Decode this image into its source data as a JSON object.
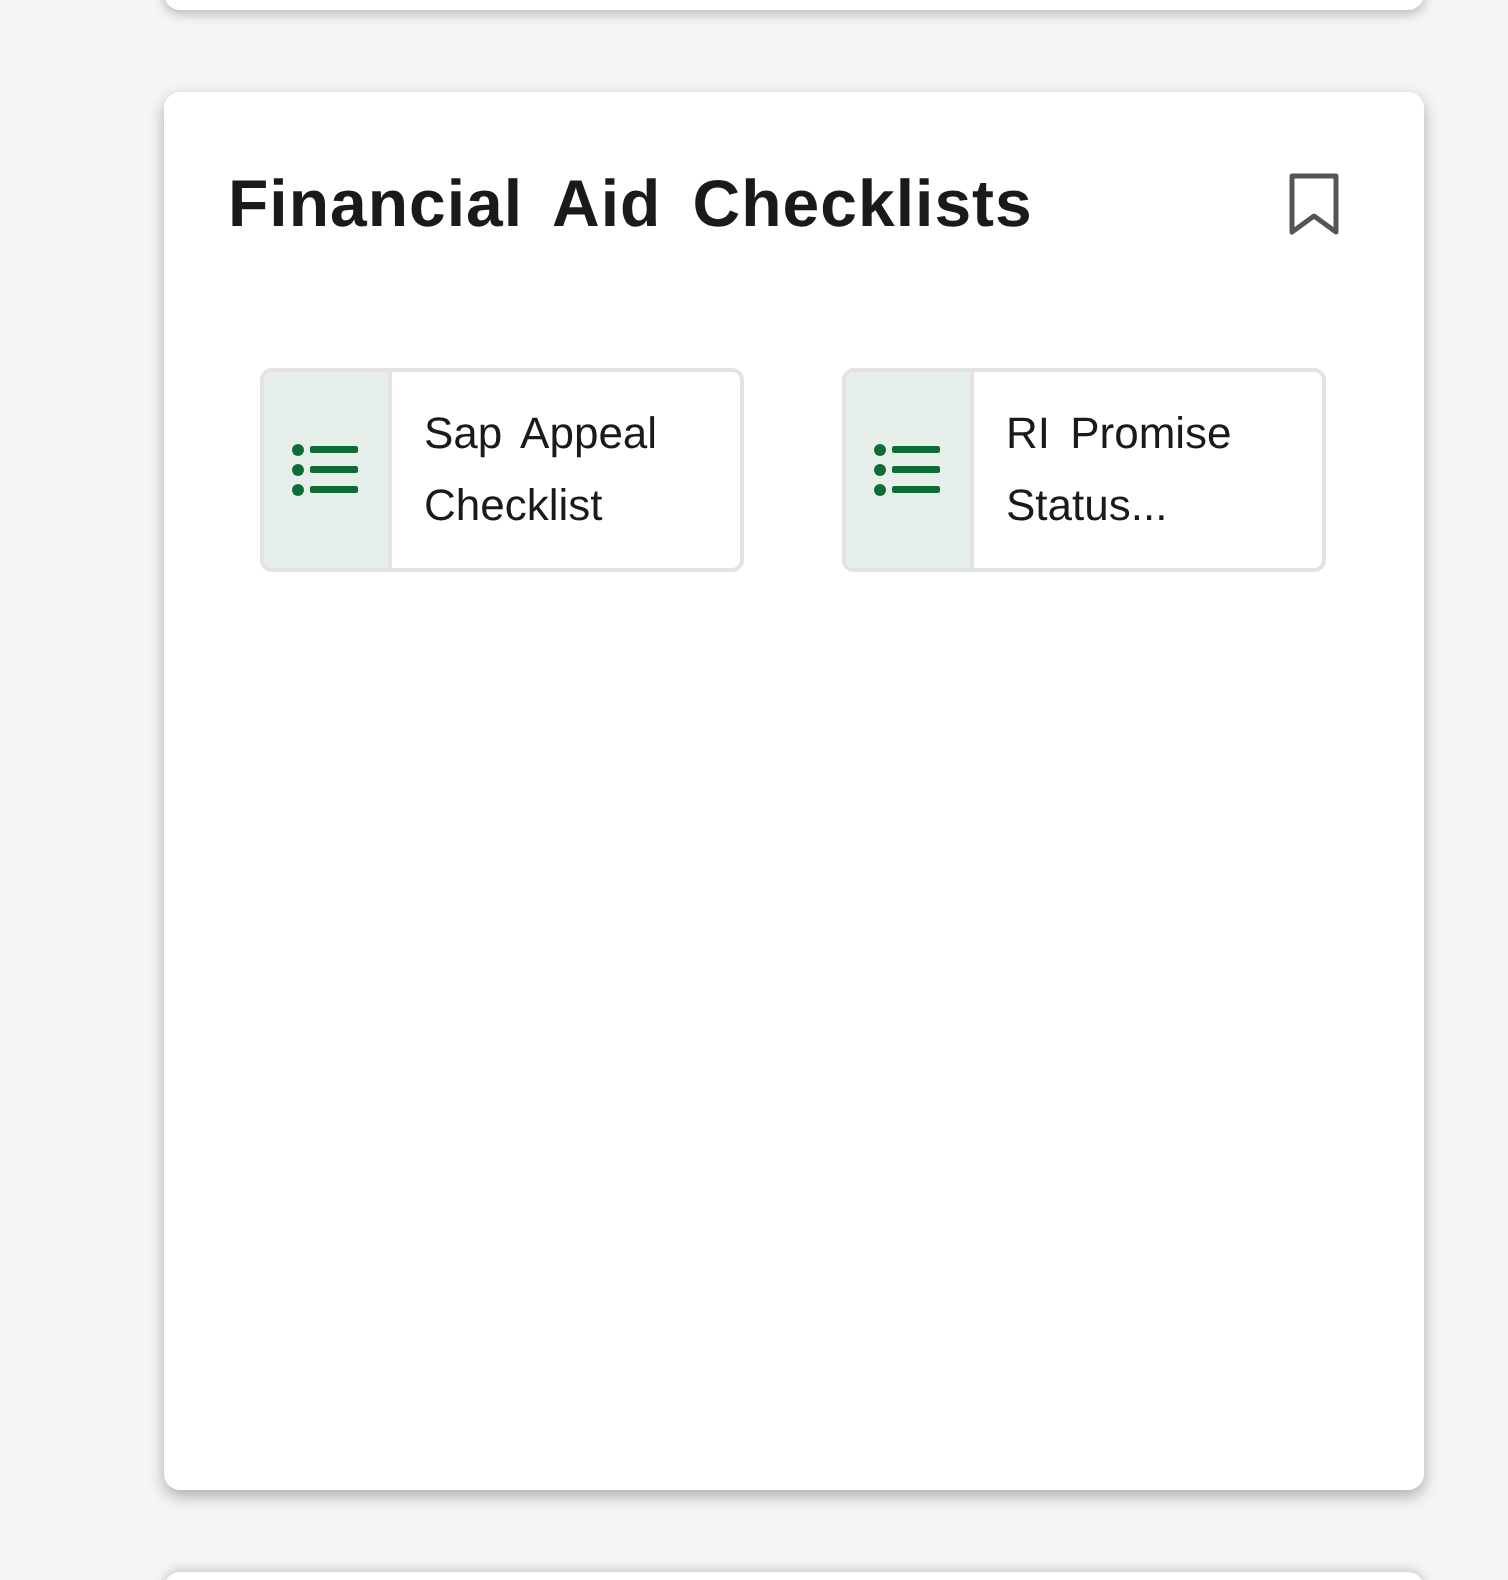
{
  "card": {
    "title": "Financial Aid Checklists",
    "bookmarked": false,
    "items": [
      {
        "label": "Sap Appeal Checklist"
      },
      {
        "label": "RI Promise Status..."
      }
    ]
  }
}
